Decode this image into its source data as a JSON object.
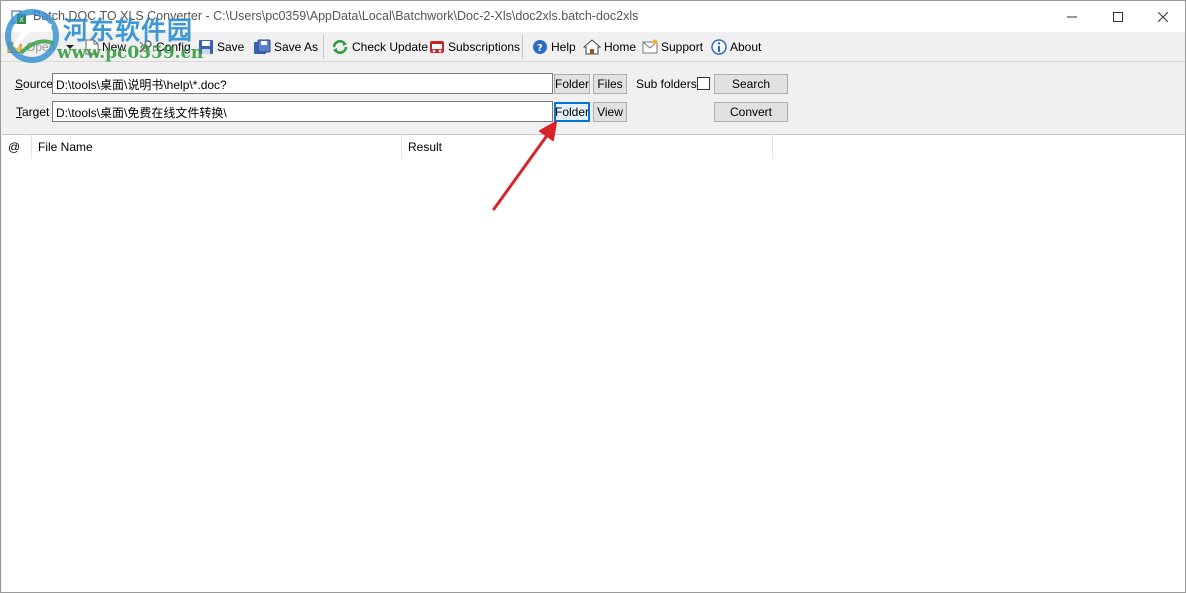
{
  "window": {
    "title": "Batch DOC TO XLS Converter - C:\\Users\\pc0359\\AppData\\Local\\Batchwork\\Doc-2-Xls\\doc2xls.batch-doc2xls"
  },
  "watermark": {
    "title": "河东软件园",
    "url": "www.pc0359.cn"
  },
  "toolbar": {
    "open": "Open",
    "new": "New",
    "config": "Config",
    "save": "Save",
    "save_as": "Save As",
    "check_update": "Check Update",
    "subscriptions": "Subscriptions",
    "help": "Help",
    "home": "Home",
    "support": "Support",
    "about": "About"
  },
  "form": {
    "source_label_accel": "S",
    "source_label_rest": "ource",
    "source_value": "D:\\tools\\桌面\\说明书\\help\\*.doc?",
    "target_label_accel": "T",
    "target_label_rest": "arget",
    "target_value": "D:\\tools\\桌面\\免费在线文件转换\\",
    "folder": "Folder",
    "files": "Files",
    "view": "View",
    "sub_folders": "Sub folders",
    "sub_folders_checked": false,
    "search": "Search",
    "convert": "Convert"
  },
  "list": {
    "columns": [
      "@",
      "File Name",
      "Result"
    ]
  },
  "colors": {
    "accent": "#0078d7",
    "annotation_arrow": "#d9232a"
  }
}
